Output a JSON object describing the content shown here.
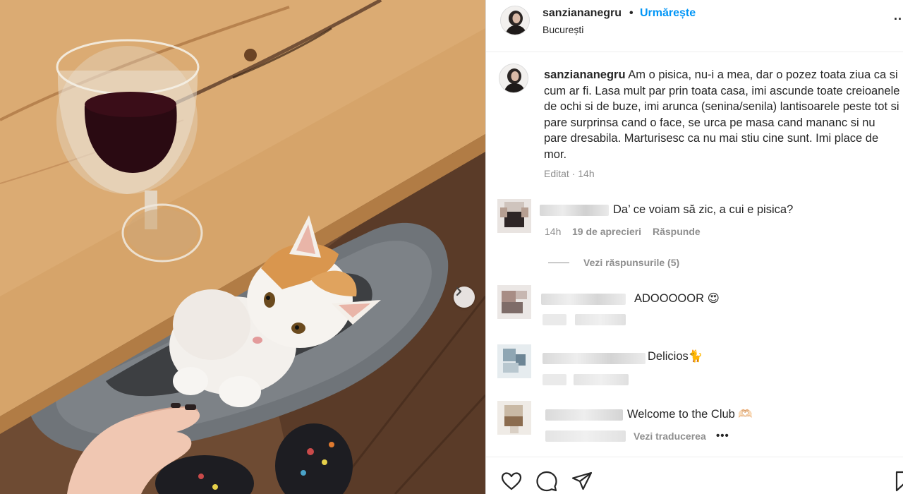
{
  "post": {
    "username": "sanziananegru",
    "separator": "•",
    "follow_label": "Urmărește",
    "location": "București",
    "more_label": "...",
    "next_icon": "chevron-right-icon"
  },
  "caption": {
    "username": "sanziananegru",
    "text": "Am o pisica, nu-i a mea, dar o pozez toata ziua ca si cum ar fi. Lasa mult par prin toata casa, imi ascunde toate creioanele de ochi si de buze, imi arunca (senina/senila) lantisoarele peste tot si pare surprinsa cand o face, se urca pe masa cand mananc si nu pare dresabila. Marturisesc ca nu mai stiu cine sunt. Imi place de mor.",
    "edited": "Editat",
    "dot": "·",
    "time": "14h"
  },
  "comments": [
    {
      "text": "Da’ ce voiam să zic, a cui e pisica?",
      "time": "14h",
      "likes": "19 de aprecieri",
      "reply": "Răspunde",
      "view_replies": "Vezi răspunsurile (5)"
    },
    {
      "text": "ADOOOOOR 😍"
    },
    {
      "text": "Delicios🐈"
    },
    {
      "text": "Welcome to the Club 🫶🏻",
      "translate": "Vezi traducerea",
      "more": "•••"
    }
  ],
  "actions": {
    "like_icon": "heart-icon",
    "comment_icon": "comment-icon",
    "share_icon": "send-icon",
    "save_icon": "bookmark-icon"
  },
  "colors": {
    "accent": "#0095f6",
    "secondary_text": "#8e8e8e",
    "primary_text": "#262626"
  }
}
